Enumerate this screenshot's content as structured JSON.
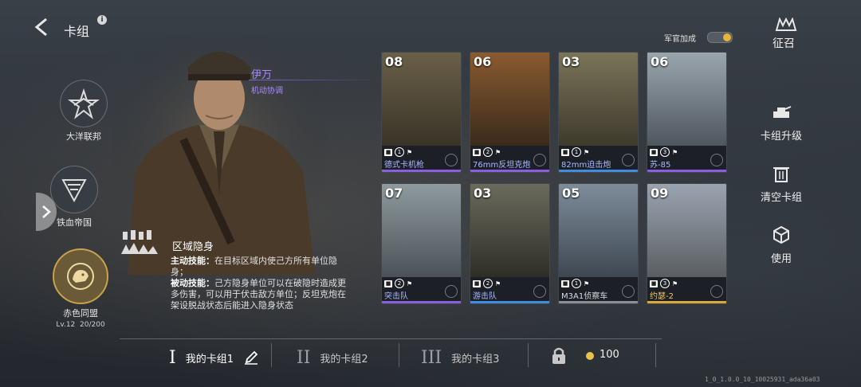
{
  "header": {
    "title": "卡组",
    "info_icon": "i"
  },
  "factions": [
    {
      "label": "大洋联邦",
      "icon": "eagle-star-icon"
    },
    {
      "label": "铁血帝国",
      "icon": "eagle-shield-icon"
    },
    {
      "label": "赤色同盟",
      "icon": "bear-icon",
      "level": "Lv.12",
      "progress": "20/200",
      "active": true
    }
  ],
  "commander": {
    "name": "伊万",
    "role": "机动协调",
    "skill_title": "区域隐身",
    "active_label": "主动技能：",
    "active_text": "在目标区域内使己方所有单位隐身；",
    "passive_label": "被动技能：",
    "passive_text": "己方隐身单位可以在破隐时造成更多伤害，可以用于伏击敌方单位；反坦克炮在架设脱战状态后能进入隐身状态"
  },
  "officer_bonus": {
    "label": "军官加成",
    "enabled": true
  },
  "actions": {
    "recruit": "征召",
    "upgrade": "卡组升级",
    "clear": "清空卡组",
    "use": "使用"
  },
  "cards": [
    {
      "cost": "08",
      "name": "德式卡机枪",
      "count": "1",
      "rarity": "purple"
    },
    {
      "cost": "06",
      "name": "76mm反坦克炮",
      "count": "2",
      "rarity": "purple"
    },
    {
      "cost": "03",
      "name": "82mm迫击炮",
      "count": "1",
      "rarity": "blue"
    },
    {
      "cost": "06",
      "name": "苏-85",
      "count": "3",
      "rarity": "purple"
    },
    {
      "cost": "07",
      "name": "突击队",
      "count": "2",
      "rarity": "purple"
    },
    {
      "cost": "03",
      "name": "游击队",
      "count": "2",
      "rarity": "blue"
    },
    {
      "cost": "05",
      "name": "M3A1侦察车",
      "count": "1",
      "rarity": "gray"
    },
    {
      "cost": "09",
      "name": "约瑟-2",
      "count": "3",
      "rarity": "gold"
    }
  ],
  "rarity_colors": {
    "purple": "#8a5ee0",
    "blue": "#3f8de0",
    "gray": "#8a8f96",
    "gold": "#d9a73a"
  },
  "tabs": [
    {
      "roman": "I",
      "label": "我的卡组1",
      "active": true
    },
    {
      "roman": "II",
      "label": "我的卡组2"
    },
    {
      "roman": "III",
      "label": "我的卡组3"
    }
  ],
  "currency": {
    "value": "100"
  },
  "version": "1_0_1.0.0_10_10025931_ada36a03"
}
